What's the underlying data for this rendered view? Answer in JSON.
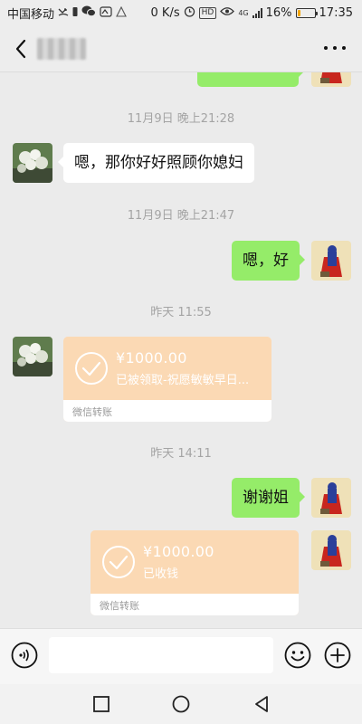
{
  "status_bar": {
    "carrier": "中国移动",
    "net_speed": "0 K/s",
    "network": "4G",
    "battery": "16%",
    "battery_level": 0.16,
    "time": "17:35"
  },
  "header": {
    "contact_name_blurred": true
  },
  "messages": [
    {
      "type": "time",
      "text": "11月9日 晚上21:28"
    },
    {
      "type": "text",
      "side": "left",
      "text": "嗯，那你好好照顾你媳妇"
    },
    {
      "type": "time",
      "text": "11月9日 晚上21:47"
    },
    {
      "type": "text",
      "side": "right",
      "text": "嗯，好"
    },
    {
      "type": "time",
      "text": "昨天 11:55"
    },
    {
      "type": "transfer",
      "side": "left",
      "amount": "¥1000.00",
      "status": "已被领取-祝愿敏敏早日...",
      "label": "微信转账"
    },
    {
      "type": "time",
      "text": "昨天 14:11"
    },
    {
      "type": "text",
      "side": "right",
      "text": "谢谢姐"
    },
    {
      "type": "transfer",
      "side": "right",
      "amount": "¥1000.00",
      "status": "已收钱",
      "label": "微信转账"
    }
  ],
  "input": {
    "value": "",
    "placeholder": ""
  },
  "icons": {
    "back": "back-arrow-icon",
    "more": "more-dots-icon",
    "voice": "voice-icon",
    "emoji": "emoji-icon",
    "plus": "plus-icon",
    "check": "check-circle-icon"
  },
  "colors": {
    "chat_background": "#ebebeb",
    "my_bubble": "#95ec69",
    "their_bubble": "#ffffff",
    "transfer_card": "#fbd9b4",
    "time_label": "#a4a4a4"
  }
}
